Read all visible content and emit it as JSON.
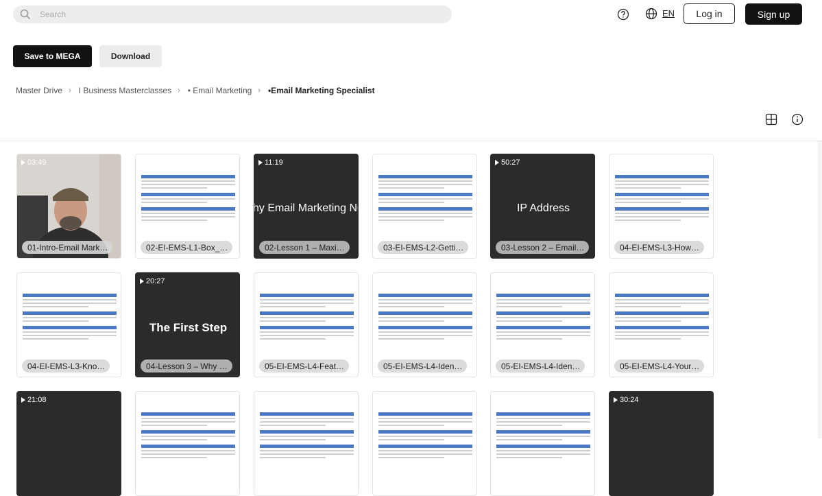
{
  "search": {
    "placeholder": "Search"
  },
  "header": {
    "lang": "EN",
    "login": "Log in",
    "signup": "Sign up"
  },
  "actions": {
    "save": "Save to MEGA",
    "download": "Download"
  },
  "breadcrumb": [
    "Master Drive",
    "I Business Masterclasses",
    "• Email Marketing",
    "•Email Marketing Specialist"
  ],
  "tiles": [
    {
      "label": "01-Intro-Email Mark…",
      "duration": "03:49",
      "type": "video"
    },
    {
      "label": "02-EI-EMS-L1-Box_…",
      "duration": "",
      "type": "doc"
    },
    {
      "label": "02-Lesson 1 – Maxi…",
      "duration": "11:19",
      "type": "dark",
      "title": "hy Email Marketing No"
    },
    {
      "label": "03-EI-EMS-L2-Getti…",
      "duration": "",
      "type": "doc"
    },
    {
      "label": "03-Lesson 2 – Email…",
      "duration": "50:27",
      "type": "dark",
      "title": "IP Address"
    },
    {
      "label": "04-EI-EMS-L3-How…",
      "duration": "",
      "type": "doc"
    },
    {
      "label": "04-EI-EMS-L3-Kno…",
      "duration": "",
      "type": "doc"
    },
    {
      "label": "04-Lesson 3 – Why …",
      "duration": "20:27",
      "type": "dark",
      "title": "The First Step"
    },
    {
      "label": "05-EI-EMS-L4-Feat…",
      "duration": "",
      "type": "doc"
    },
    {
      "label": "05-EI-EMS-L4-Iden…",
      "duration": "",
      "type": "doc"
    },
    {
      "label": "05-EI-EMS-L4-Iden…",
      "duration": "",
      "type": "doc"
    },
    {
      "label": "05-EI-EMS-L4-Your…",
      "duration": "",
      "type": "doc"
    },
    {
      "label": "",
      "duration": "21:08",
      "type": "dark",
      "title": ""
    },
    {
      "label": "",
      "duration": "",
      "type": "doc"
    },
    {
      "label": "",
      "duration": "",
      "type": "doc"
    },
    {
      "label": "",
      "duration": "",
      "type": "doc"
    },
    {
      "label": "",
      "duration": "",
      "type": "doc"
    },
    {
      "label": "",
      "duration": "30:24",
      "type": "dark",
      "title": ""
    }
  ],
  "icons": {
    "search": "search-icon",
    "help": "help-circle-icon",
    "globe": "globe-icon",
    "grid": "grid-view-icon",
    "info": "info-icon",
    "chevron": "chevron-right-icon"
  },
  "colors": {
    "primary": "#111111",
    "doc_accent": "#4a78c2"
  }
}
